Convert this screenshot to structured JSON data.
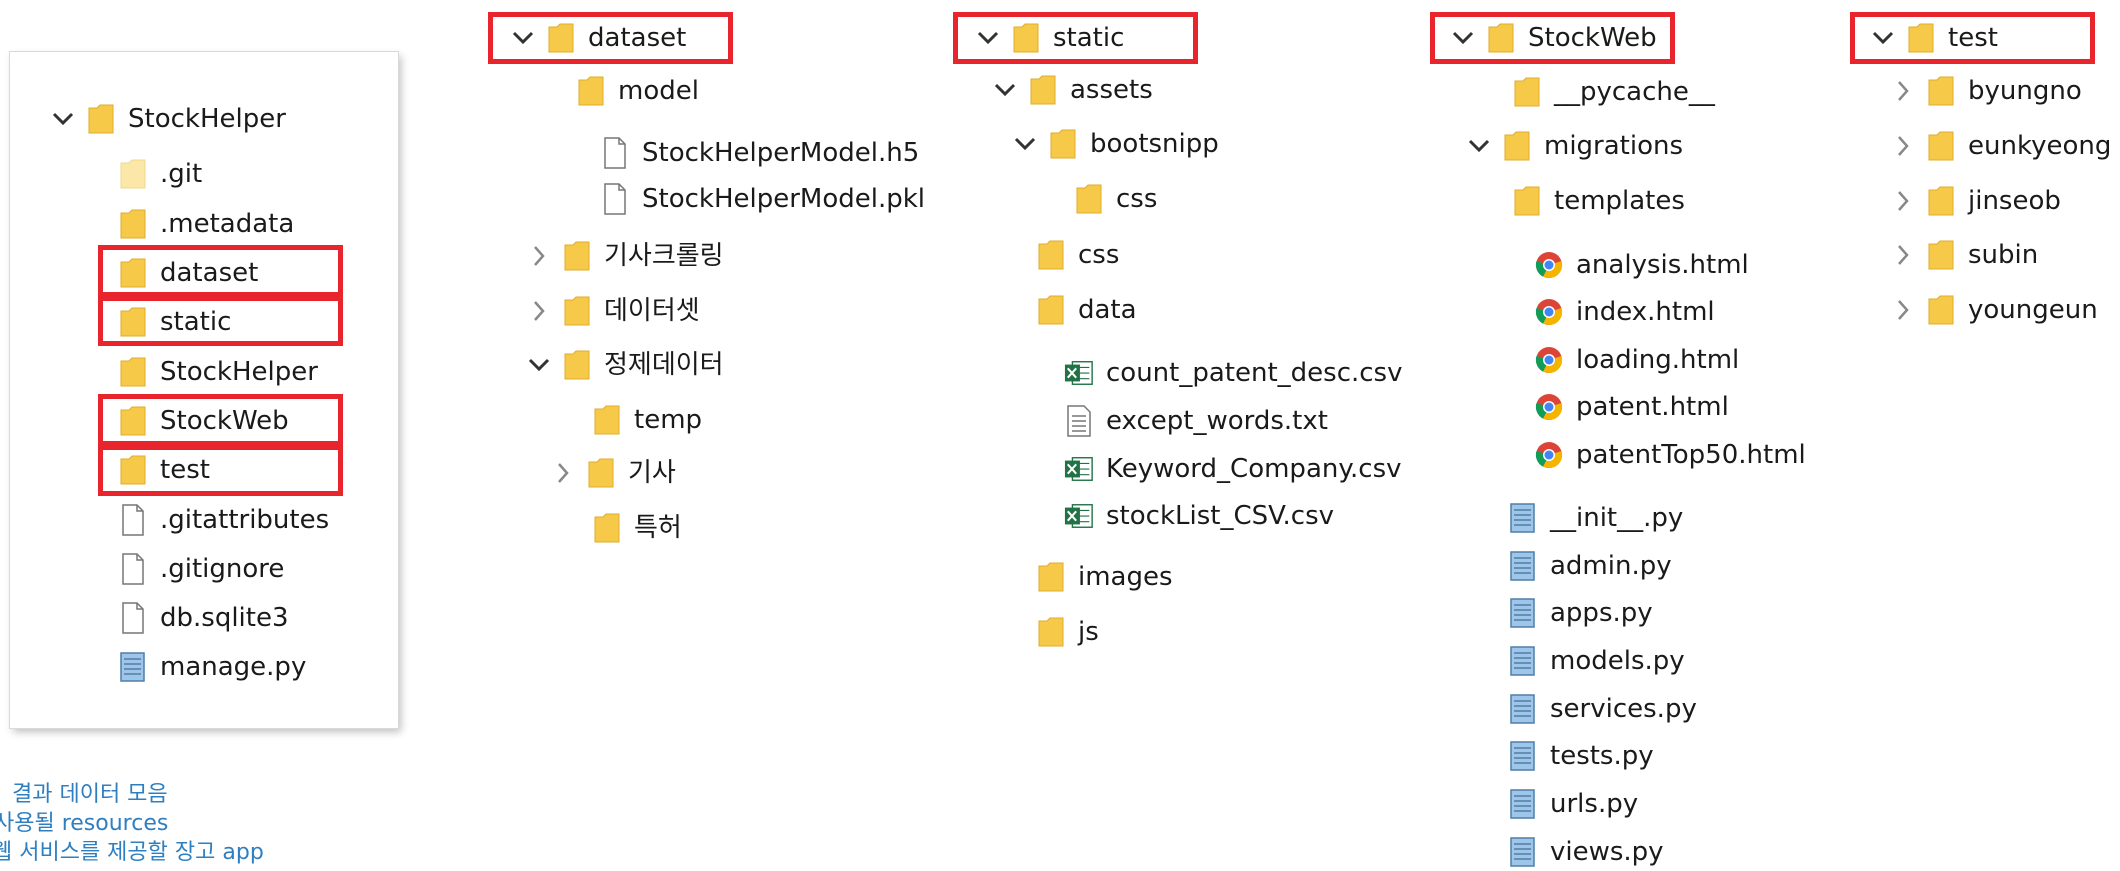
{
  "colors": {
    "highlight": "#e8242c",
    "folder": "#f7c948",
    "note_text": "#2e7fc1"
  },
  "root_tree": {
    "root": "StockHelper",
    "items": [
      {
        "label": ".git",
        "icon": "folder-faded-icon"
      },
      {
        "label": ".metadata",
        "icon": "folder-icon"
      },
      {
        "label": "dataset",
        "icon": "folder-icon",
        "highlighted": true
      },
      {
        "label": "static",
        "icon": "folder-icon",
        "highlighted": true
      },
      {
        "label": "StockHelper",
        "icon": "folder-icon"
      },
      {
        "label": "StockWeb",
        "icon": "folder-icon",
        "highlighted": true
      },
      {
        "label": "test",
        "icon": "folder-icon",
        "highlighted": true
      },
      {
        "label": ".gitattributes",
        "icon": "file-icon"
      },
      {
        "label": ".gitignore",
        "icon": "file-icon"
      },
      {
        "label": "db.sqlite3",
        "icon": "file-icon"
      },
      {
        "label": "manage.py",
        "icon": "python-file-icon"
      }
    ]
  },
  "dataset_tree": {
    "root": "dataset",
    "model": "model",
    "model_files": [
      "StockHelperModel.h5",
      "StockHelperModel.pkl"
    ],
    "folder_crawling": "기사크롤링",
    "folder_dataset": "데이터셋",
    "folder_refined": "정제데이터",
    "refined_children": [
      "temp",
      "기사",
      "특허"
    ]
  },
  "static_tree": {
    "root": "static",
    "assets": "assets",
    "bootsnipp": "bootsnipp",
    "bootsnipp_css": "css",
    "css": "css",
    "data": "data",
    "data_files": [
      "count_patent_desc.csv",
      "except_words.txt",
      "Keyword_Company.csv",
      "stockList_CSV.csv"
    ],
    "images": "images",
    "js": "js"
  },
  "stockweb_tree": {
    "root": "StockWeb",
    "pycache": "__pycache__",
    "migrations": "migrations",
    "templates": "templates",
    "template_files": [
      "analysis.html",
      "index.html",
      "loading.html",
      "patent.html",
      "patentTop50.html"
    ],
    "py_files": [
      "__init__.py",
      "admin.py",
      "apps.py",
      "models.py",
      "services.py",
      "tests.py",
      "urls.py",
      "views.py"
    ]
  },
  "test_tree": {
    "root": "test",
    "children": [
      "byungno",
      "eunkyeong",
      "jinseob",
      "subin",
      "youngeun"
    ]
  },
  "notes": [
    "결과 데이터 모음",
    "사용될 resources",
    "웹 서비스를 제공할 장고 app"
  ]
}
